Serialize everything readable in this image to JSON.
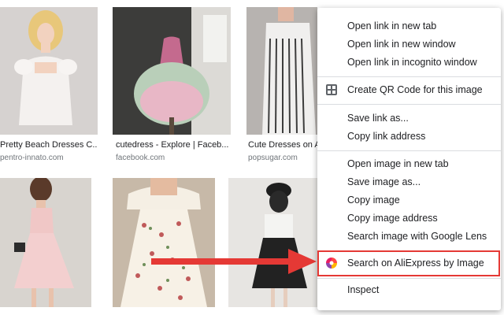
{
  "results": [
    {
      "caption": "Pretty Beach Dresses C...",
      "source": "pentro-innato.com"
    },
    {
      "caption": "cutedress - Explore | Faceb...",
      "source": "facebook.com"
    },
    {
      "caption": "Cute Dresses on A...",
      "source": "popsugar.com"
    }
  ],
  "context_menu": {
    "items": [
      {
        "label": "Open link in new tab"
      },
      {
        "label": "Open link in new window"
      },
      {
        "label": "Open link in incognito window"
      },
      {
        "label": "Create QR Code for this image",
        "icon": "qr-code-icon"
      },
      {
        "label": "Save link as..."
      },
      {
        "label": "Copy link address"
      },
      {
        "label": "Open image in new tab"
      },
      {
        "label": "Save image as..."
      },
      {
        "label": "Copy image"
      },
      {
        "label": "Copy image address"
      },
      {
        "label": "Search image with Google Lens"
      },
      {
        "label": "Search on AliExpress by Image",
        "icon": "aliexpress-icon",
        "highlighted": true
      },
      {
        "label": "Inspect"
      }
    ]
  },
  "colors": {
    "highlight_border": "#e53935",
    "arrow": "#e53935"
  }
}
